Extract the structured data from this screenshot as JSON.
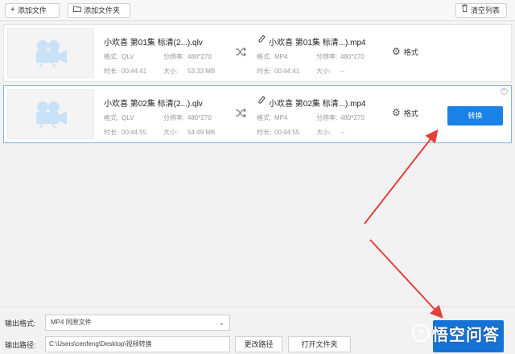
{
  "toolbar": {
    "add_file": "添加文件",
    "add_folder": "添加文件夹",
    "clear_list": "清空列表"
  },
  "items": [
    {
      "source_name": "小欢喜 第01集 标清(2...).qlv",
      "format_label": "格式:",
      "format": "QLV",
      "resolution_label": "分辨率:",
      "resolution": "480*270",
      "duration_label": "时长:",
      "duration": "00:44:41",
      "size_label": "大小:",
      "size": "53.33 MB",
      "output_name": "小欢喜 第01集 标清...).mp4",
      "out_format_label": "格式:",
      "out_format": "MP4",
      "out_resolution_label": "分辨率:",
      "out_resolution": "480*270",
      "out_duration_label": "时长:",
      "out_duration": "00:44:41",
      "out_size_label": "大小:",
      "out_size": "--",
      "format_button": "格式"
    },
    {
      "source_name": "小欢喜 第02集 标清(2...).qlv",
      "format_label": "格式:",
      "format": "QLV",
      "resolution_label": "分辨率:",
      "resolution": "480*270",
      "duration_label": "时长:",
      "duration": "00:44:55",
      "size_label": "大小:",
      "size": "54.49 MB",
      "output_name": "小欢喜 第02集 标清...).mp4",
      "out_format_label": "格式:",
      "out_format": "MP4",
      "out_resolution_label": "分辨率:",
      "out_resolution": "480*270",
      "out_duration_label": "时长:",
      "out_duration": "00:44:55",
      "out_size_label": "大小:",
      "out_size": "--",
      "format_button": "格式",
      "convert_button": "转换"
    }
  ],
  "bottom": {
    "output_format_label": "输出格式:",
    "output_format_value": "MP4 同原文件",
    "output_path_label": "输出路径:",
    "output_path_value": "C:\\Users\\cenfeng\\Desktop\\视频转换",
    "change_path": "更改路径",
    "open_folder": "打开文件夹"
  },
  "watermark": {
    "text": "悟空问答"
  },
  "colors": {
    "accent": "#1a82e6",
    "annotation_arrow": "#e2403a",
    "selected_border": "#7fb2e8"
  },
  "icons": {
    "thumbnail": "film-camera-icon",
    "conversion": "shuffle-icon",
    "rename": "pencil-icon",
    "settings": "gear-icon"
  }
}
